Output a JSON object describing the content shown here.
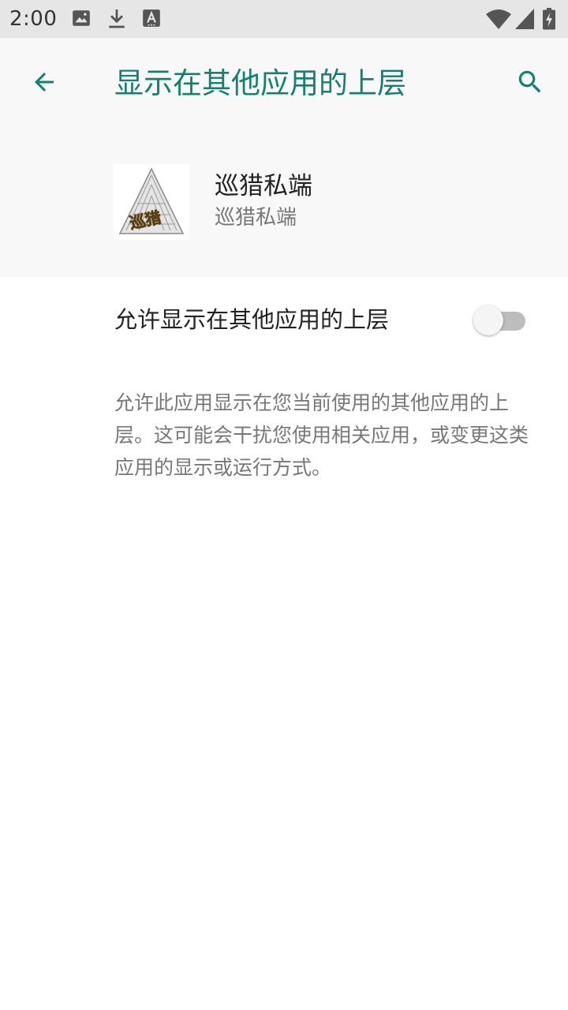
{
  "status_bar": {
    "time": "2:00",
    "icons": [
      "image-icon",
      "download-icon",
      "text-a-icon",
      "wifi-icon",
      "signal-icon",
      "battery-charging-icon"
    ]
  },
  "toolbar": {
    "title": "显示在其他应用的上层",
    "back_icon": "arrow-back-icon",
    "search_icon": "search-icon",
    "accent_color": "#14806f"
  },
  "app": {
    "name": "巡猎私端",
    "subtitle": "巡猎私端",
    "icon_text": "巡猎"
  },
  "setting": {
    "label": "允许显示在其他应用的上层",
    "enabled": false
  },
  "description": "允许此应用显示在您当前使用的其他应用的上层。这可能会干扰您使用相关应用，或变更这类应用的显示或运行方式。"
}
